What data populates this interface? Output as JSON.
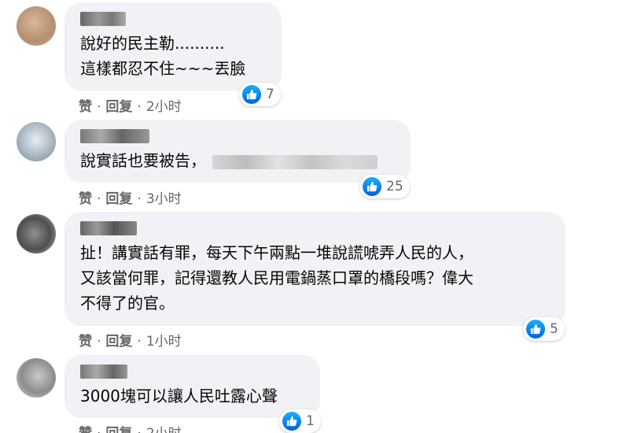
{
  "colors": {
    "bubble_bg": "#f0f2f5",
    "text": "#050505",
    "muted": "#65676b",
    "like_blue": "#1877f2"
  },
  "comments": [
    {
      "author": "[blurred]",
      "text": "說好的民主勒..........\n這樣都忍不住~~~丟臉",
      "like_label": "赞",
      "reply_label": "回复",
      "time": "2小时",
      "reactions": "7"
    },
    {
      "author": "[blurred]",
      "text": "說實話也要被告，",
      "like_label": "赞",
      "reply_label": "回复",
      "time": "3小时",
      "reactions": "25"
    },
    {
      "author": "[blurred]",
      "text": "扯！講實話有罪，每天下午兩點一堆說謊唬弄人民的人，\n又該當何罪，記得還教人民用電鍋蒸口罩的橋段嗎？偉大\n不得了的官。",
      "like_label": "赞",
      "reply_label": "回复",
      "time": "1小时",
      "reactions": "5"
    },
    {
      "author": "[blurred]",
      "text": "3000塊可以讓人民吐露心聲",
      "like_label": "赞",
      "reply_label": "回复",
      "time": "2小时",
      "reactions": "1"
    }
  ]
}
